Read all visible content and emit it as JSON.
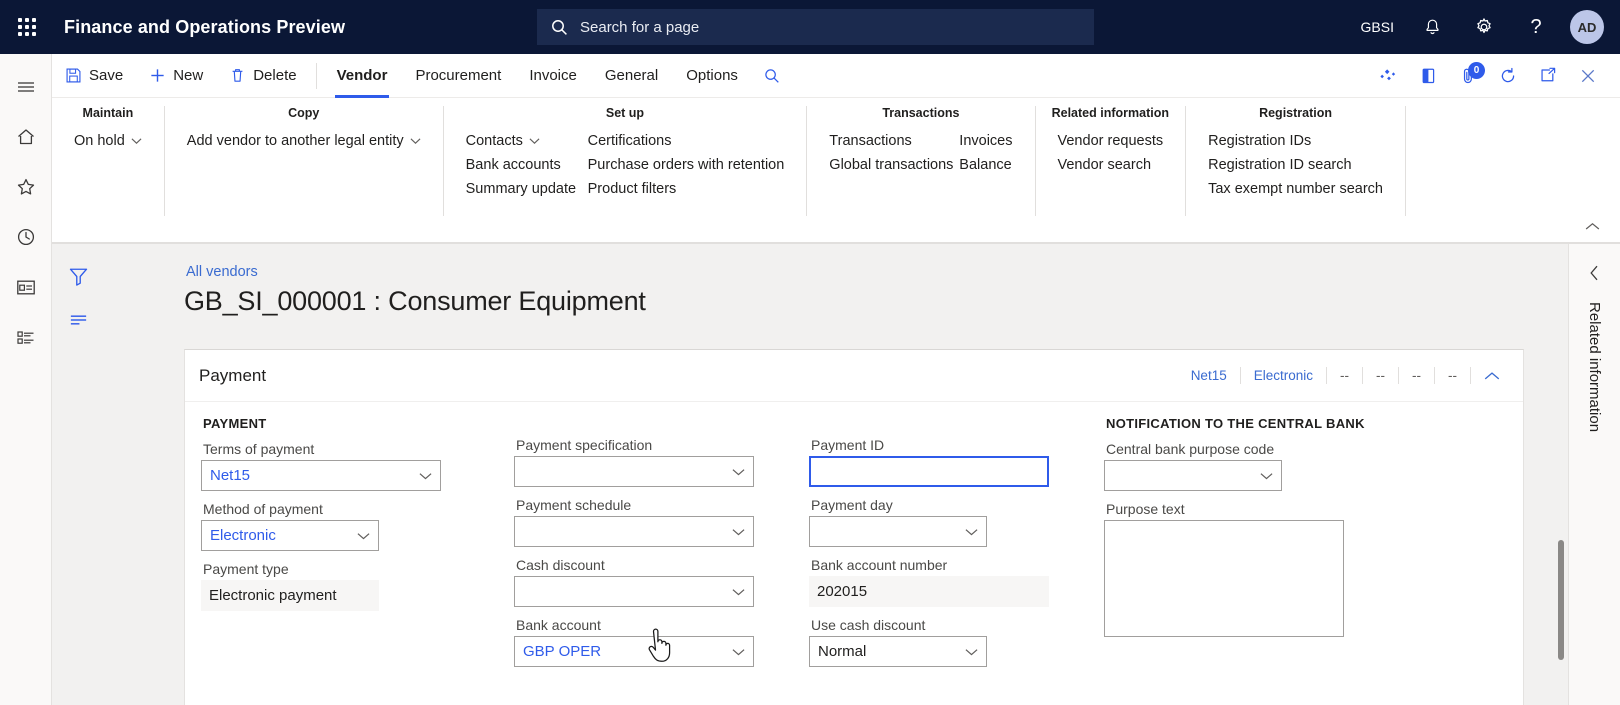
{
  "topbar": {
    "app_title": "Finance and Operations Preview",
    "waffle_icon": "app-launcher-icon",
    "search": {
      "placeholder": "Search for a page",
      "icon": "search-icon"
    },
    "company": "GBSI",
    "notifications_icon": "bell-icon",
    "settings_icon": "gear-icon",
    "help_icon": "question-mark-icon",
    "avatar_initials": "AD",
    "bg_color": "#0b1736"
  },
  "rail": {
    "items": [
      {
        "icon": "hamburger-menu-icon",
        "name": "navigation-menu"
      },
      {
        "icon": "home-icon",
        "name": "home"
      },
      {
        "icon": "star-icon",
        "name": "favorites"
      },
      {
        "icon": "clock-icon",
        "name": "recent"
      },
      {
        "icon": "workspaces-icon",
        "name": "workspaces"
      },
      {
        "icon": "modules-list-icon",
        "name": "modules"
      }
    ]
  },
  "commandbar": {
    "save_label": "Save",
    "new_label": "New",
    "delete_label": "Delete",
    "tabs": [
      {
        "label": "Vendor",
        "active": true
      },
      {
        "label": "Procurement",
        "active": false
      },
      {
        "label": "Invoice",
        "active": false
      },
      {
        "label": "General",
        "active": false
      },
      {
        "label": "Options",
        "active": false
      }
    ],
    "search_icon": "search-icon",
    "right_icons": [
      {
        "name": "power-bi-icon"
      },
      {
        "name": "office-icon"
      },
      {
        "name": "attachments-icon",
        "badge": "0"
      },
      {
        "name": "refresh-icon"
      },
      {
        "name": "open-in-new-window-icon"
      },
      {
        "name": "close-icon"
      }
    ]
  },
  "ribbon": {
    "collapse_icon": "chevron-up-icon",
    "groups": [
      {
        "title": "Maintain",
        "columns": [
          [
            {
              "label": "On hold",
              "dropdown": true
            }
          ]
        ]
      },
      {
        "title": "Copy",
        "columns": [
          [
            {
              "label": "Add vendor to another legal entity",
              "dropdown": true
            }
          ]
        ]
      },
      {
        "title": "Set up",
        "columns": [
          [
            {
              "label": "Contacts",
              "dropdown": true
            },
            {
              "label": "Bank accounts",
              "dropdown": false
            },
            {
              "label": "Summary update",
              "dropdown": false
            }
          ],
          [
            {
              "label": "Certifications",
              "dropdown": false
            },
            {
              "label": "Purchase orders with retention",
              "dropdown": false
            },
            {
              "label": "Product filters",
              "dropdown": false
            }
          ]
        ]
      },
      {
        "title": "Transactions",
        "columns": [
          [
            {
              "label": "Transactions",
              "dropdown": false
            },
            {
              "label": "Global transactions",
              "dropdown": false
            }
          ],
          [
            {
              "label": "Invoices",
              "dropdown": false
            },
            {
              "label": "Balance",
              "dropdown": false
            }
          ]
        ]
      },
      {
        "title": "Related information",
        "columns": [
          [
            {
              "label": "Vendor requests",
              "dropdown": false
            },
            {
              "label": "Vendor search",
              "dropdown": false
            }
          ]
        ]
      },
      {
        "title": "Registration",
        "columns": [
          [
            {
              "label": "Registration IDs",
              "dropdown": false
            },
            {
              "label": "Registration ID search",
              "dropdown": false
            },
            {
              "label": "Tax exempt number search",
              "dropdown": false
            }
          ]
        ]
      }
    ]
  },
  "workspace_rail": {
    "items": [
      {
        "icon": "filter-icon",
        "name": "filter-pane"
      },
      {
        "icon": "list-lines-icon",
        "name": "show-list"
      }
    ]
  },
  "page": {
    "breadcrumb": "All vendors",
    "title": "GB_SI_000001 : Consumer Equipment"
  },
  "card": {
    "title": "Payment",
    "summary": [
      "Net15",
      "Electronic",
      "--",
      "--",
      "--",
      "--"
    ],
    "collapse_icon": "chevron-up-icon",
    "groups": {
      "payment_label": "PAYMENT",
      "notification_label": "NOTIFICATION TO THE CENTRAL BANK"
    },
    "fields": {
      "terms_of_payment": {
        "label": "Terms of payment",
        "value": "Net15"
      },
      "method_of_payment": {
        "label": "Method of payment",
        "value": "Electronic"
      },
      "payment_type": {
        "label": "Payment type",
        "value": "Electronic payment"
      },
      "payment_specification": {
        "label": "Payment specification",
        "value": ""
      },
      "payment_schedule": {
        "label": "Payment schedule",
        "value": ""
      },
      "cash_discount": {
        "label": "Cash discount",
        "value": ""
      },
      "bank_account": {
        "label": "Bank account",
        "value": "GBP OPER"
      },
      "payment_id": {
        "label": "Payment ID",
        "value": ""
      },
      "payment_day": {
        "label": "Payment day",
        "value": ""
      },
      "bank_account_number": {
        "label": "Bank account number",
        "value": "202015"
      },
      "use_cash_discount": {
        "label": "Use cash discount",
        "value": "Normal"
      },
      "central_bank_purpose_code": {
        "label": "Central bank purpose code",
        "value": ""
      },
      "purpose_text": {
        "label": "Purpose text",
        "value": ""
      }
    }
  },
  "right_pane": {
    "label": "Related information",
    "collapse_icon": "chevron-left-icon"
  },
  "colors": {
    "accent": "#2f5bea",
    "link": "#3a6bd0",
    "nav_bg": "#0b1736",
    "workspace_bg": "#f2f1f0"
  }
}
